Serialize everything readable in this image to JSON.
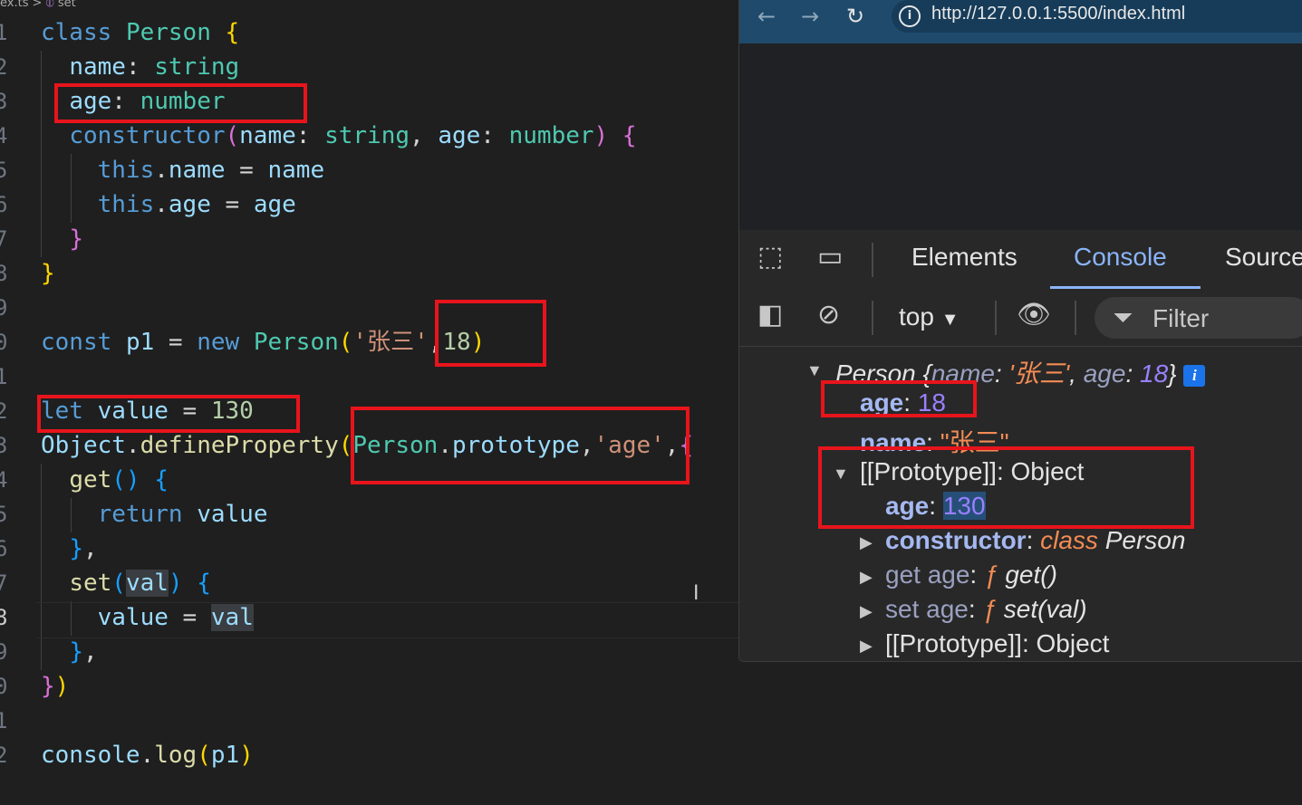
{
  "editor": {
    "breadcrumb": {
      "file": "ex.ts",
      "symbol": "set"
    },
    "line_numbers": [
      "1",
      "2",
      "3",
      "4",
      "5",
      "6",
      "7",
      "8",
      "9",
      "0",
      "1",
      "2",
      "3",
      "4",
      "5",
      "6",
      "7",
      "8",
      "9",
      "0",
      "1",
      "2"
    ],
    "code": {
      "kw_class": "class",
      "Person": "Person",
      "name": "name",
      "age": "age",
      "string": "string",
      "number": "number",
      "constructor": "constructor",
      "this": "this",
      "const": "const",
      "p1": "p1",
      "new": "new",
      "zhangsan": "'张三'",
      "num18": "18",
      "let": "let",
      "value": "value",
      "num130": "130",
      "Object": "Object",
      "defineProperty": "defineProperty",
      "prototype": "prototype",
      "age_str": "'age'",
      "get": "get",
      "return": "return",
      "set": "set",
      "val": "val",
      "console": "console",
      "log": "log"
    }
  },
  "browser": {
    "nav": {
      "back": "←",
      "forward": "→",
      "reload": "C"
    },
    "url": "http://127.0.0.1:5500/index.html",
    "devtools": {
      "tabs": [
        "Elements",
        "Console",
        "Sources"
      ],
      "active_tab": "Console",
      "context": "top",
      "filter_placeholder": "Filter"
    },
    "console": {
      "summary": {
        "class": "Person",
        "name_key": "name",
        "name_val": "'张三'",
        "age_key": "age",
        "age_val": "18",
        "badge": "i"
      },
      "own_age": {
        "key": "age",
        "val": "18"
      },
      "own_name": {
        "key": "name",
        "val": "\"张三\""
      },
      "proto_label": "[[Prototype]]: Object",
      "proto_age": {
        "key": "age",
        "val": "130"
      },
      "ctor": {
        "key": "constructor",
        "kw": "class",
        "val": "Person"
      },
      "getter": {
        "key": "get age",
        "f": "ƒ",
        "val": "get()"
      },
      "setter": {
        "key": "set age",
        "f": "ƒ",
        "val": "set(val)"
      },
      "proto2_label": "[[Prototype]]: Object"
    }
  }
}
